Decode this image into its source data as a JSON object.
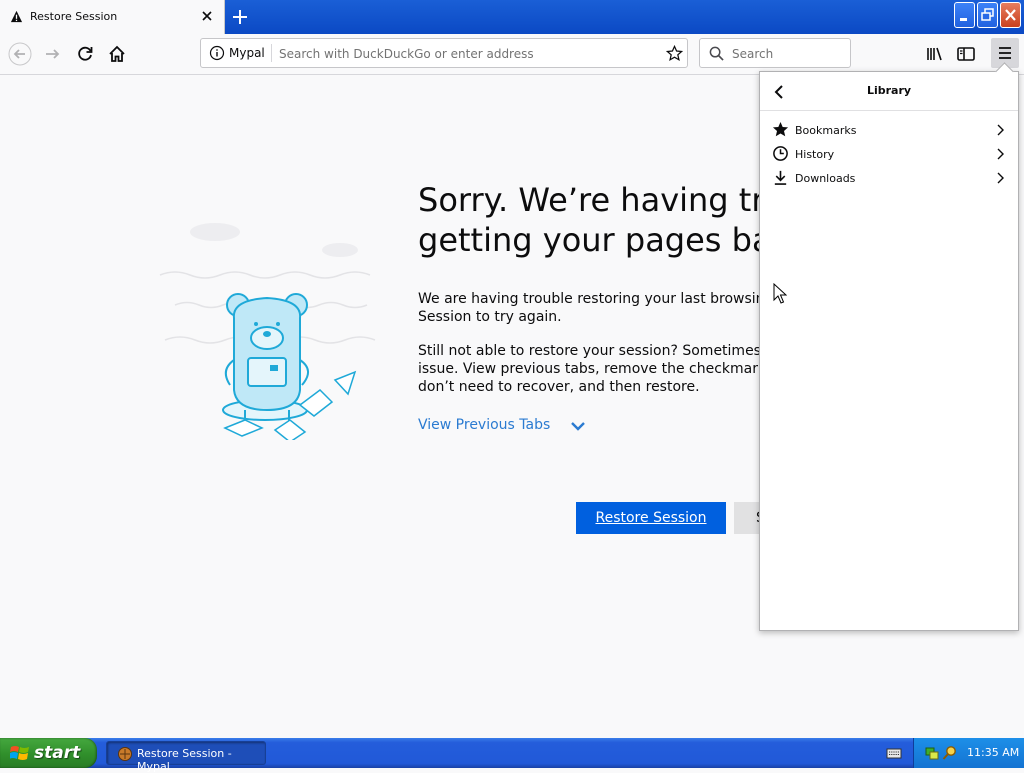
{
  "tab": {
    "title": "Restore Session",
    "icon": "warning-icon"
  },
  "urlbar": {
    "site_label": "Mypal",
    "placeholder": "Search with DuckDuckGo or enter address"
  },
  "searchbar": {
    "placeholder": "Search"
  },
  "content": {
    "heading_lines": [
      "Sorry. We’re having trou",
      "getting your pages back"
    ],
    "para1_lines": [
      "We are having trouble restoring your last browsing se",
      "Session to try again."
    ],
    "para2_lines": [
      "Still not able to restore your session? Sometimes a ta",
      "issue. View previous tabs, remove the checkmark fro",
      "don’t need to recover, and then restore."
    ],
    "view_tabs_label": "View Previous Tabs",
    "restore_button_label": "Restore Session",
    "start_new_button_label": "S"
  },
  "library": {
    "title": "Library",
    "items": [
      {
        "label": "Bookmarks",
        "icon": "star-icon"
      },
      {
        "label": "History",
        "icon": "clock-icon"
      },
      {
        "label": "Downloads",
        "icon": "download-icon"
      }
    ]
  },
  "taskbar": {
    "start_label": "start",
    "task_label": "Restore Session - Mypal",
    "clock": "11:35 AM"
  },
  "colors": {
    "accent_blue": "#0060df",
    "link_blue": "#2b7bd1",
    "taskbar_blue": "#245ddb",
    "start_green": "#308f2b"
  }
}
